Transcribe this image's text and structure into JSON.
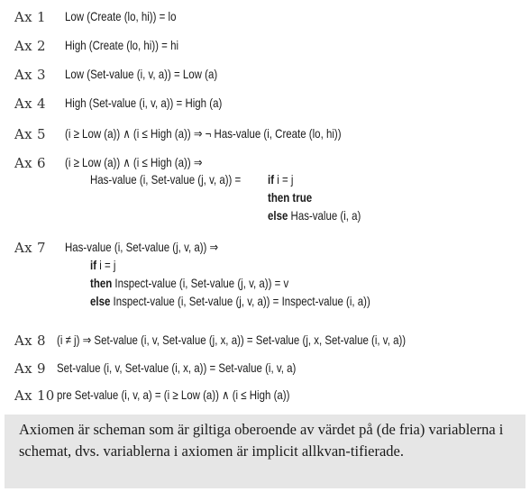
{
  "axioms": [
    {
      "label": "Ax 1",
      "lines": [
        "Low (Create (lo, hi)) = lo"
      ]
    },
    {
      "label": "Ax 2",
      "lines": [
        "High (Create (lo, hi)) = hi"
      ]
    },
    {
      "label": "Ax 3",
      "lines": [
        "Low (Set-value (i, v, a)) = Low (a)"
      ]
    },
    {
      "label": "Ax 4",
      "lines": [
        "High (Set-value (i, v, a)) = High (a)"
      ]
    },
    {
      "label": "Ax 5",
      "lines": [
        "(i ≥ Low (a)) ∧  (i ≤ High (a))  ⇒  ¬ Has-value (i, Create (lo, hi))"
      ]
    },
    {
      "label": "Ax 6",
      "lines": [
        "(i ≥ Low (a)) ∧ (i ≤ High (a))  ⇒",
        "Has-value (i, Set-value (j, v, a)) =",
        {
          "kw": "if",
          "rest": " i = j"
        },
        {
          "kw": "then true",
          "rest": ""
        },
        {
          "kw": "else",
          "rest": " Has-value (i, a)"
        }
      ]
    },
    {
      "label": "Ax 7",
      "lines": [
        "Has-value (i, Set-value (j, v, a))  ⇒",
        {
          "kw": "if",
          "rest": " i = j"
        },
        {
          "kw": "then",
          "rest": " Inspect-value (i, Set-value (j, v, a)) = v"
        },
        {
          "kw": "else",
          "rest": " Inspect-value (i, Set-value (j, v, a)) = Inspect-value (i, a))"
        }
      ]
    },
    {
      "label": "Ax 8",
      "lines": [
        "(i ≠ j)  ⇒  Set-value (i, v, Set-value (j, x, a))  =  Set-value (j, x, Set-value (i, v, a))"
      ]
    },
    {
      "label": "Ax 9",
      "lines": [
        "Set-value (i, v, Set-value (i, x, a))  =  Set-value (i, v, a)"
      ]
    },
    {
      "label": "Ax 10",
      "lines": [
        "pre Set-value (i, v, a) = (i ≥ Low (a)) ∧ (i ≤ High (a))"
      ]
    }
  ],
  "note": "Axiomen är scheman som är giltiga oberoende av värdet på (de fria) variablerna i schemat, dvs. variablerna i axiomen är implicit allkvan-tifierade."
}
